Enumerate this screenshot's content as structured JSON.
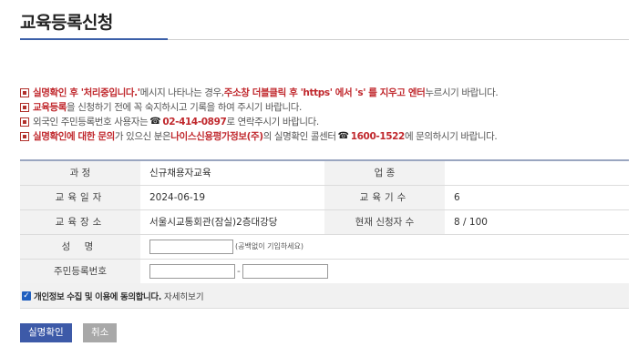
{
  "page": {
    "title": "교육등록신청"
  },
  "notices": [
    {
      "parts": [
        {
          "t": "실명확인 후 '처리중입니다.'",
          "s": "red"
        },
        {
          "t": "메시지 나타나는 경우, ",
          "s": "n"
        },
        {
          "t": "주소창 더블클릭 후 'https' 에서 's' 를 지우고 엔터",
          "s": "red"
        },
        {
          "t": " 누르시기 바랍니다.",
          "s": "n"
        }
      ]
    },
    {
      "parts": [
        {
          "t": "교육등록",
          "s": "red"
        },
        {
          "t": "을 신청하기 전에 꼭 숙지하시고 기록을 하여 주시기 바랍니다.",
          "s": "n"
        }
      ]
    },
    {
      "parts": [
        {
          "t": "외국인 주민등록번호 사용자는 ",
          "s": "n"
        },
        {
          "t": "☎",
          "s": "icon"
        },
        {
          "t": "02-414-0897",
          "s": "red"
        },
        {
          "t": " 로 연락주시기 바랍니다.",
          "s": "n"
        }
      ]
    },
    {
      "parts": [
        {
          "t": "실명확인에 대한 문의",
          "s": "red"
        },
        {
          "t": "가 있으신 분은 ",
          "s": "n"
        },
        {
          "t": "나이스신용평가정보(주)",
          "s": "red"
        },
        {
          "t": "의 실명확인 콜센터 ",
          "s": "n"
        },
        {
          "t": "☎",
          "s": "icon"
        },
        {
          "t": "1600-1522",
          "s": "red"
        },
        {
          "t": " 에 문의하시기 바랍니다.",
          "s": "n"
        }
      ]
    }
  ],
  "form": {
    "course_label": "과 정",
    "course_value": "신규채용자교육",
    "job_label": "업 종",
    "job_value": "",
    "date_label": "교육일자",
    "date_value": "2024-06-19",
    "count_label": "교육기수",
    "count_value": "6",
    "place_label": "교육장소",
    "place_value": "서울시교통회관(잠실)2층대강당",
    "applicants_label": "현재 신청자 수",
    "applicants_value": "8 / 100",
    "name_label": "성 명",
    "name_value": "",
    "name_hint": "(공백없이 기입하세요)",
    "rrn_label": "주민등록번호",
    "rrn_value_1": "",
    "rrn_separator": "-",
    "rrn_value_2": ""
  },
  "consent": {
    "checked": true,
    "label": "개인정보 수집 및 이용에 동의합니다.",
    "details_link": "자세히보기"
  },
  "buttons": {
    "verify": "실명확인",
    "cancel": "취소"
  },
  "colors": {
    "accent": "#3d5aa8",
    "warning": "#c0282d",
    "cancel": "#a8a8a8"
  }
}
